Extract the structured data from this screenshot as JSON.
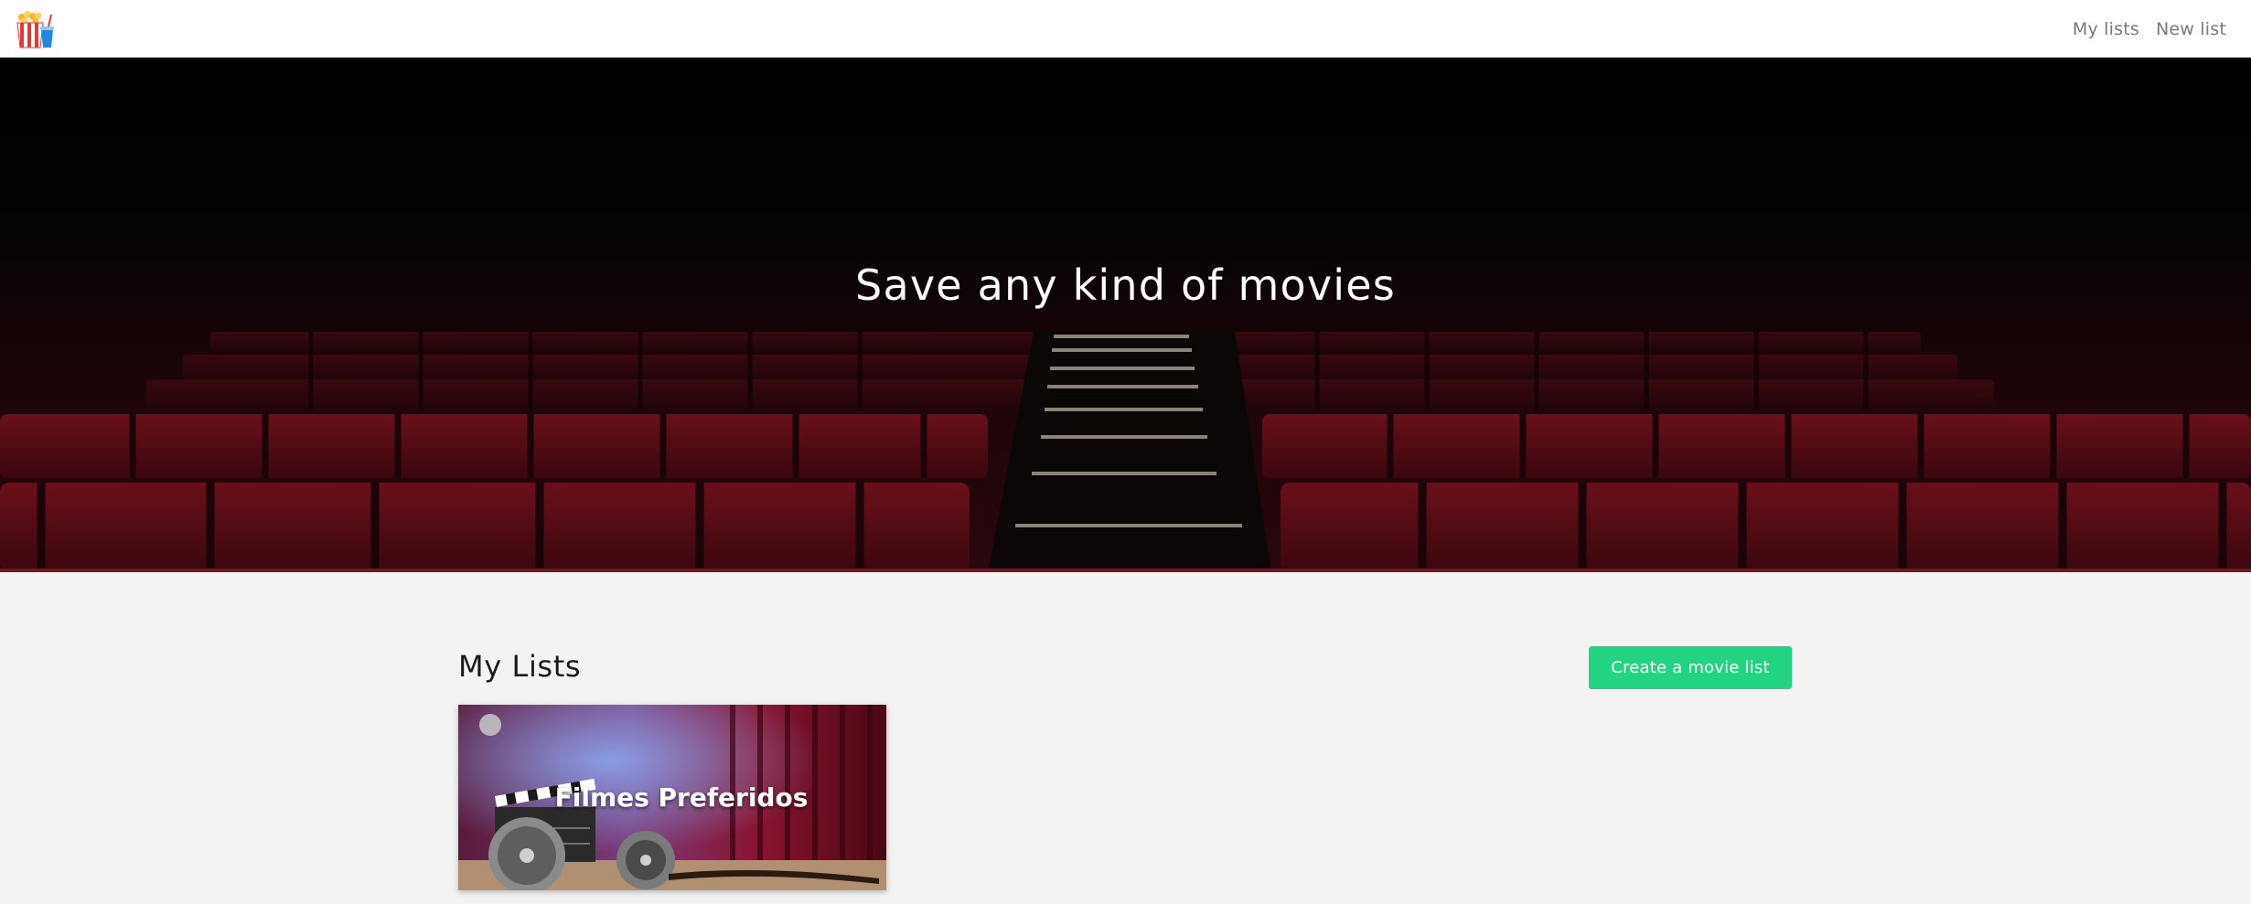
{
  "nav": {
    "logo_icon": "popcorn-drink-icon",
    "links": [
      {
        "label": "My lists"
      },
      {
        "label": "New list"
      }
    ]
  },
  "hero": {
    "title": "Save any kind of movies"
  },
  "main": {
    "section_title": "My Lists",
    "create_button_label": "Create a movie list",
    "lists": [
      {
        "title": "Filmes Preferidos"
      }
    ]
  },
  "colors": {
    "accent": "#22d482",
    "nav_link": "#7a7a7a",
    "background": "#f3f3f3",
    "seat_red": "#5a0c14"
  }
}
